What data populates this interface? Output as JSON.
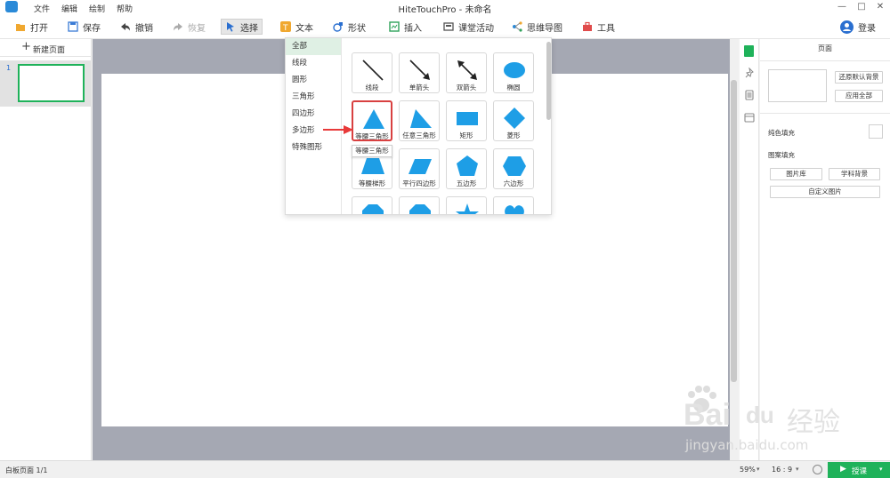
{
  "titlebar": {
    "menus": [
      "文件",
      "编辑",
      "绘制",
      "帮助"
    ],
    "title": "HiteTouchPro - 未命名",
    "controls": [
      "—",
      "□",
      "✕"
    ]
  },
  "toolbar": {
    "open": "打开",
    "save": "保存",
    "undo": "撤销",
    "redo": "恢复",
    "select": "选择",
    "text": "文本",
    "shape": "形状",
    "insert": "插入",
    "activity": "课堂活动",
    "mindmap": "思维导图",
    "tools": "工具",
    "login": "登录"
  },
  "left_panel": {
    "new_page": "新建页面",
    "page_number": "1"
  },
  "shape_menu": {
    "categories": [
      "全部",
      "线段",
      "圆形",
      "三角形",
      "四边形",
      "多边形",
      "特殊图形"
    ],
    "selected_category": "全部",
    "shapes": [
      "线段",
      "单箭头",
      "双箭头",
      "椭圆",
      "等腰三角形",
      "任意三角形",
      "矩形",
      "菱形",
      "等腰梯形",
      "平行四边形",
      "五边形",
      "六边形"
    ],
    "tooltip": "等腰三角形",
    "shape_color": "#1e9ee6"
  },
  "right_panel": {
    "title": "页面",
    "restore_bg": "还原默认背景",
    "apply_all": "应用全部",
    "solid_fill": "纯色填充",
    "pattern_fill": "图案填充",
    "gallery": "图片库",
    "subject_bg": "学科背景",
    "custom_image": "自定义图片"
  },
  "status_bar": {
    "page_info": "白板页面 1/1",
    "zoom": "59%",
    "ratio": "16 : 9",
    "teach_button": "授课",
    "teach_color": "#1fb25a"
  },
  "watermark": {
    "brand": "Bai",
    "du": "du",
    "jingyan": "经验",
    "url": "jingyan.baidu.com"
  }
}
